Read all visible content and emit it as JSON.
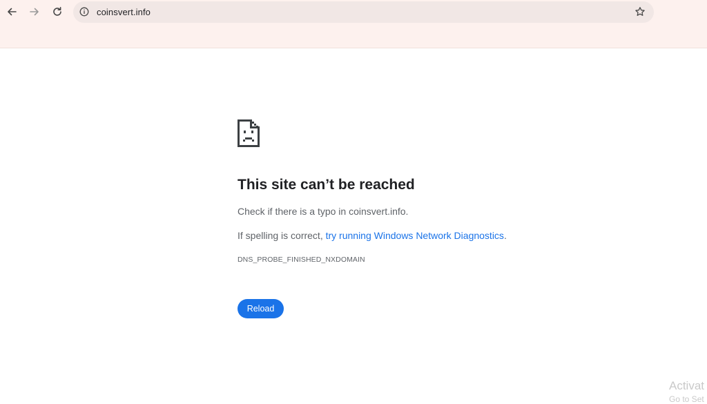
{
  "browser": {
    "url": "coinsvert.info"
  },
  "error": {
    "title": "This site can’t be reached",
    "suggestion_1": "Check if there is a typo in coinsvert.info.",
    "suggestion_2_prefix": "If spelling is correct, ",
    "suggestion_2_link": "try running Windows Network Diagnostics",
    "suggestion_2_suffix": ".",
    "code": "DNS_PROBE_FINISHED_NXDOMAIN",
    "reload_label": "Reload"
  },
  "watermark": {
    "line1": "Activat",
    "line2": "Go to Set"
  },
  "colors": {
    "toolbar_bg": "#fdf1ee",
    "omnibox_bg": "#f1e7e5",
    "accent": "#1a73e8",
    "text_primary": "#202124",
    "text_secondary": "#5f6368"
  },
  "icons": {
    "back": "arrow-left-icon",
    "forward": "arrow-right-icon",
    "reload": "reload-icon",
    "site_info": "info-icon",
    "bookmark": "star-icon",
    "error": "sad-document-icon"
  }
}
